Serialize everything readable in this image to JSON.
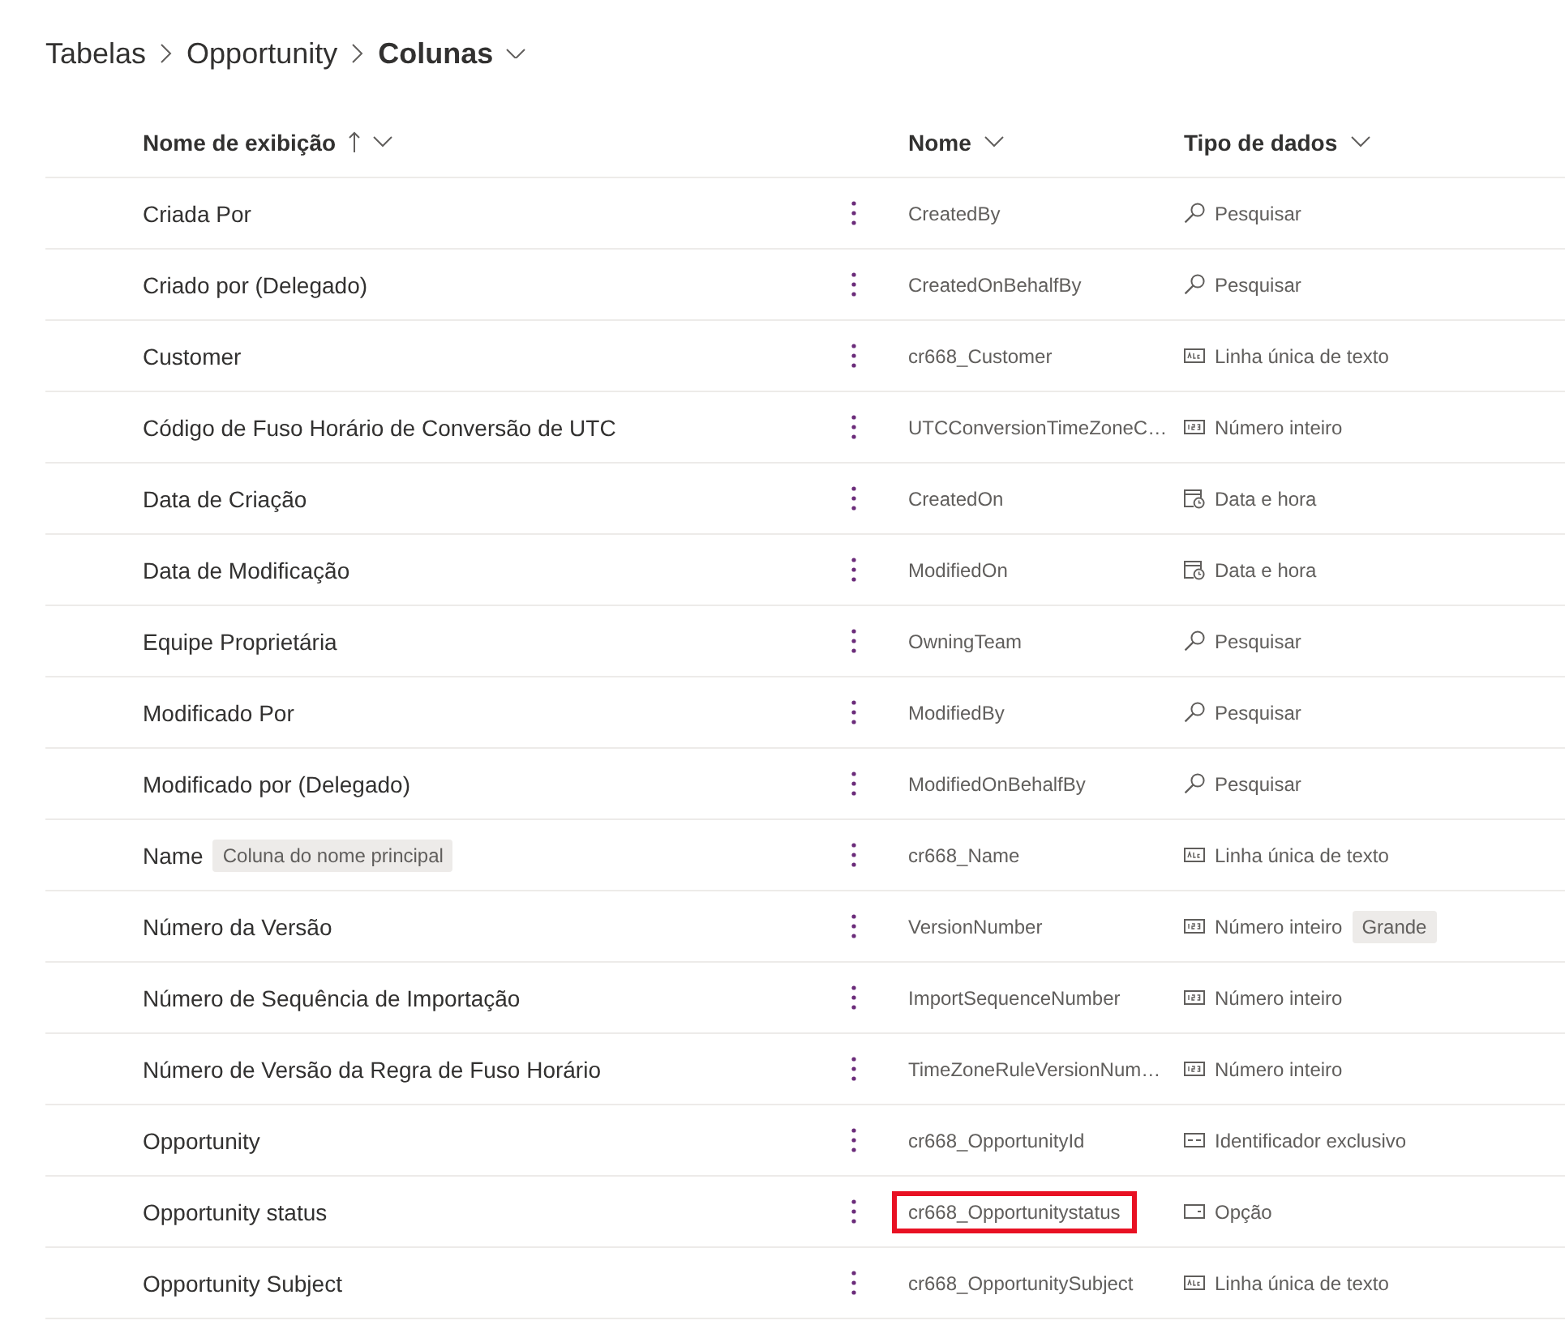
{
  "breadcrumb": [
    {
      "label": "Tabelas",
      "current": false
    },
    {
      "label": "Opportunity",
      "current": false
    },
    {
      "label": "Colunas",
      "current": true
    }
  ],
  "columns": [
    {
      "label": "Nome de exibição",
      "sorted": true
    },
    {
      "label": "Nome",
      "sorted": false
    },
    {
      "label": "Tipo de dados",
      "sorted": false
    }
  ],
  "rows": [
    {
      "display_name": "Criada Por",
      "logical_name": "CreatedBy",
      "data_type": {
        "kind": "lookup",
        "label": "Pesquisar"
      },
      "highlighted": false
    },
    {
      "display_name": "Criado por (Delegado)",
      "logical_name": "CreatedOnBehalfBy",
      "data_type": {
        "kind": "lookup",
        "label": "Pesquisar"
      },
      "highlighted": false
    },
    {
      "display_name": "Customer",
      "logical_name": "cr668_Customer",
      "data_type": {
        "kind": "text",
        "label": "Linha única de texto"
      },
      "highlighted": false
    },
    {
      "display_name": "Código de Fuso Horário de Conversão de UTC",
      "logical_name": "UTCConversionTimeZoneC…",
      "data_type": {
        "kind": "integer",
        "label": "Número inteiro"
      },
      "highlighted": false
    },
    {
      "display_name": "Data de Criação",
      "logical_name": "CreatedOn",
      "data_type": {
        "kind": "datetime",
        "label": "Data e hora"
      },
      "highlighted": false
    },
    {
      "display_name": "Data de Modificação",
      "logical_name": "ModifiedOn",
      "data_type": {
        "kind": "datetime",
        "label": "Data e hora"
      },
      "highlighted": false
    },
    {
      "display_name": "Equipe Proprietária",
      "logical_name": "OwningTeam",
      "data_type": {
        "kind": "lookup",
        "label": "Pesquisar"
      },
      "highlighted": false
    },
    {
      "display_name": "Modificado Por",
      "logical_name": "ModifiedBy",
      "data_type": {
        "kind": "lookup",
        "label": "Pesquisar"
      },
      "highlighted": false
    },
    {
      "display_name": "Modificado por (Delegado)",
      "logical_name": "ModifiedOnBehalfBy",
      "data_type": {
        "kind": "lookup",
        "label": "Pesquisar"
      },
      "highlighted": false
    },
    {
      "display_name": "Name",
      "display_badge": "Coluna do nome principal",
      "logical_name": "cr668_Name",
      "data_type": {
        "kind": "text",
        "label": "Linha única de texto"
      },
      "highlighted": false
    },
    {
      "display_name": "Número da Versão",
      "logical_name": "VersionNumber",
      "data_type": {
        "kind": "integer",
        "label": "Número inteiro",
        "badge": "Grande"
      },
      "highlighted": false
    },
    {
      "display_name": "Número de Sequência de Importação",
      "logical_name": "ImportSequenceNumber",
      "data_type": {
        "kind": "integer",
        "label": "Número inteiro"
      },
      "highlighted": false
    },
    {
      "display_name": "Número de Versão da Regra de Fuso Horário",
      "logical_name": "TimeZoneRuleVersionNum…",
      "data_type": {
        "kind": "integer",
        "label": "Número inteiro"
      },
      "highlighted": false
    },
    {
      "display_name": "Opportunity",
      "logical_name": "cr668_OpportunityId",
      "data_type": {
        "kind": "unique_id",
        "label": "Identificador exclusivo"
      },
      "highlighted": false
    },
    {
      "display_name": "Opportunity status",
      "logical_name": "cr668_Opportunitystatus",
      "data_type": {
        "kind": "choice",
        "label": "Opção"
      },
      "highlighted": true
    },
    {
      "display_name": "Opportunity Subject",
      "logical_name": "cr668_OpportunitySubject",
      "data_type": {
        "kind": "text",
        "label": "Linha única de texto"
      },
      "highlighted": false
    }
  ]
}
